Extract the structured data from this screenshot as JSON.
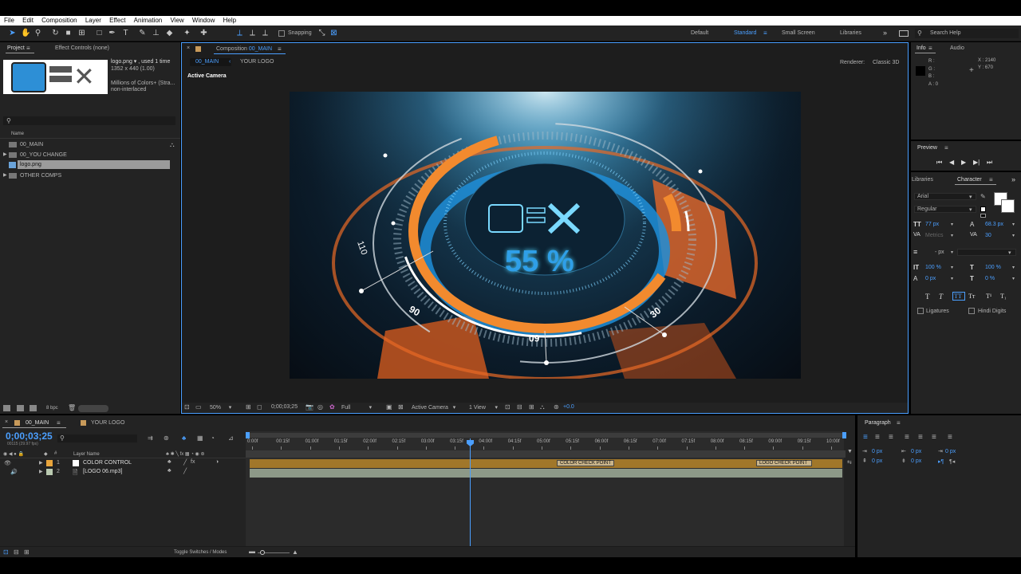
{
  "menu": [
    "File",
    "Edit",
    "Composition",
    "Layer",
    "Effect",
    "Animation",
    "View",
    "Window",
    "Help"
  ],
  "toolbar": {
    "snapping": "Snapping",
    "workspaces": [
      "Default",
      "Standard",
      "Small Screen",
      "Libraries"
    ],
    "active_workspace": "Standard",
    "search_placeholder": "Search Help"
  },
  "project_panel": {
    "tabs": [
      "Project",
      "Effect Controls (none)"
    ],
    "item_name": "logo.png",
    "used": ", used 1 time",
    "dims": "1352 x 440 (1.00)",
    "colors": "Millions of Colors+ (Stra...",
    "interlace": "non-interlaced",
    "column_name": "Name",
    "items": [
      "00_MAIN",
      "00_YOU CHANGE",
      "logo.png",
      "OTHER COMPS"
    ],
    "bpc": "8 bpc"
  },
  "comp_panel": {
    "tab_label": "Composition",
    "tab_name": "00_MAIN",
    "breadcrumbs": [
      "00_MAIN",
      "YOUR LOGO"
    ],
    "renderer_label": "Renderer:",
    "renderer": "Classic 3D",
    "camera_label": "Active Camera",
    "percent": "55 %",
    "gauge_labels": [
      "110",
      "90",
      "60",
      "30"
    ],
    "footer": {
      "zoom": "50%",
      "timecode": "0;00;03;25",
      "resolution": "Full",
      "camera": "Active Camera",
      "views": "1 View",
      "exposure": "+0.0"
    }
  },
  "info_panel": {
    "tabs": [
      "Info",
      "Audio"
    ],
    "channels": [
      "R :",
      "G :",
      "B :",
      "A : 0"
    ],
    "x": "X : 2140",
    "y": "Y : 670"
  },
  "preview_panel": {
    "title": "Preview"
  },
  "character_panel": {
    "tabs": [
      "Libraries",
      "Character"
    ],
    "font": "Arial",
    "style": "Regular",
    "size": "77 px",
    "leading": "68.3 px",
    "kerning": "Metrics",
    "tracking": "30",
    "stroke_unit": "- px",
    "vscale": "100 %",
    "hscale": "100 %",
    "baseline": "0 px",
    "tsume": "0 %",
    "style_buttons": [
      "T",
      "T",
      "TT",
      "Tт",
      "T¹",
      "T₁"
    ],
    "ligatures": "Ligatures",
    "hindi": "Hindi Digits"
  },
  "timeline": {
    "tabs": [
      "00_MAIN",
      "YOUR LOGO"
    ],
    "timecode": "0;00;03;25",
    "fps": "00115 (29.97 fps)",
    "column_header": "Layer Name",
    "ruler": [
      "0:00f",
      "00:15f",
      "01:00f",
      "01:15f",
      "02:00f",
      "02:15f",
      "03:00f",
      "03:15f",
      "04:00f",
      "04:15f",
      "05:00f",
      "05:15f",
      "06:00f",
      "06:15f",
      "07:00f",
      "07:15f",
      "08:00f",
      "08:15f",
      "09:00f",
      "09:15f",
      "10:00f"
    ],
    "layers": [
      {
        "num": "1",
        "name": "COLOR CONTROL",
        "label_color": "#e8a53c"
      },
      {
        "num": "2",
        "name": "[LOGO 06.mp3]",
        "label_color": "#b9c9b0"
      }
    ],
    "markers": [
      "COLOR CHECK POINT",
      "LOGO CHECK POINT"
    ],
    "toggle_label": "Toggle Switches / Modes"
  },
  "paragraph_panel": {
    "title": "Paragraph",
    "indents": [
      "0 px",
      "0 px",
      "0 px",
      "0 px",
      "0 px"
    ]
  },
  "colors": {
    "accent": "#4b9fff",
    "panel_bg": "#232323",
    "orange": "#f28a2e",
    "cyan": "#4fd4ff",
    "layer1_bar": "#a1772a",
    "layer2_bar": "#8d9988"
  }
}
